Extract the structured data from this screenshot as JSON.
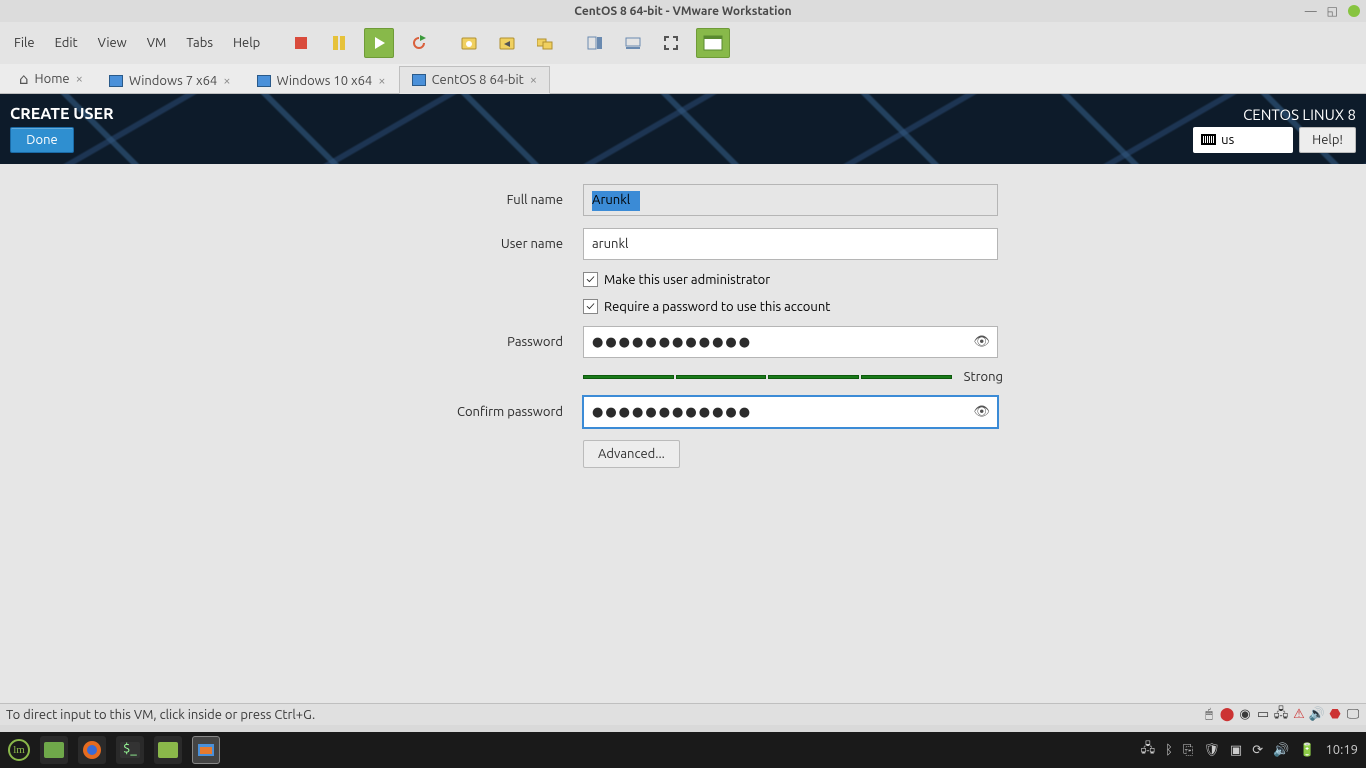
{
  "host": {
    "titlebar": {
      "text": "CentOS 8 64-bit - VMware Workstation"
    },
    "taskbar_time": "10:19"
  },
  "vmware": {
    "menu": [
      "File",
      "Edit",
      "View",
      "VM",
      "Tabs",
      "Help"
    ],
    "tabs": [
      {
        "label": "Home",
        "kind": "home"
      },
      {
        "label": "Windows 7 x64",
        "kind": "vm"
      },
      {
        "label": "Windows 10 x64",
        "kind": "vm"
      },
      {
        "label": "CentOS 8 64-bit",
        "kind": "vm",
        "active": true
      }
    ],
    "status_hint": "To direct input to this VM, click inside or press Ctrl+G."
  },
  "anaconda": {
    "title": "CREATE USER",
    "done": "Done",
    "os": "CENTOS LINUX 8",
    "keyboard": "us",
    "help": "Help!",
    "labels": {
      "fullname": "Full name",
      "username": "User name",
      "password": "Password",
      "confirm": "Confirm password"
    },
    "values": {
      "fullname": "Arunkl",
      "username": "arunkl",
      "password_mask": "●●●●●●●●●●●●",
      "confirm_mask": "●●●●●●●●●●●●"
    },
    "checks": {
      "admin": "Make this user administrator",
      "reqpw": "Require a password to use this account"
    },
    "strength": "Strong",
    "advanced": "Advanced..."
  }
}
